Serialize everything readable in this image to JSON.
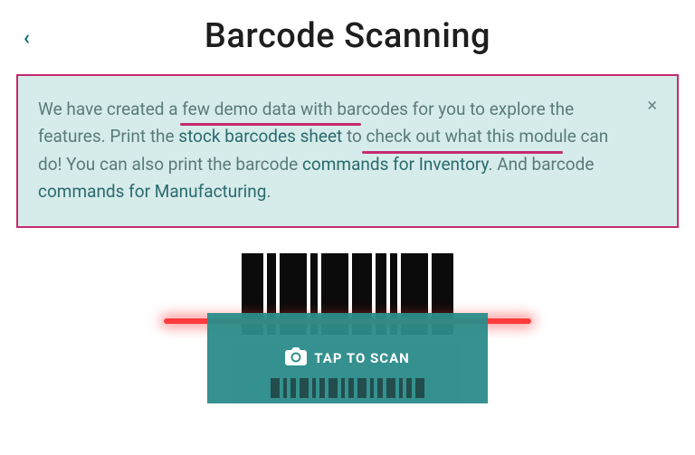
{
  "header": {
    "title": "Barcode Scanning"
  },
  "info": {
    "t1": "We have created a few demo data with barcodes for you to explore the features. Print the ",
    "link1": "stock barcodes sheet",
    "t2": " to check out what this module can do! You can also print the barcode ",
    "link2": "commands for Inventory",
    "t3": ". And barcode ",
    "bold1": "commands for Manufacturing",
    "t4": "."
  },
  "scan": {
    "label": "TAP TO SCAN"
  },
  "icons": {
    "back": "‹",
    "close": "×"
  }
}
